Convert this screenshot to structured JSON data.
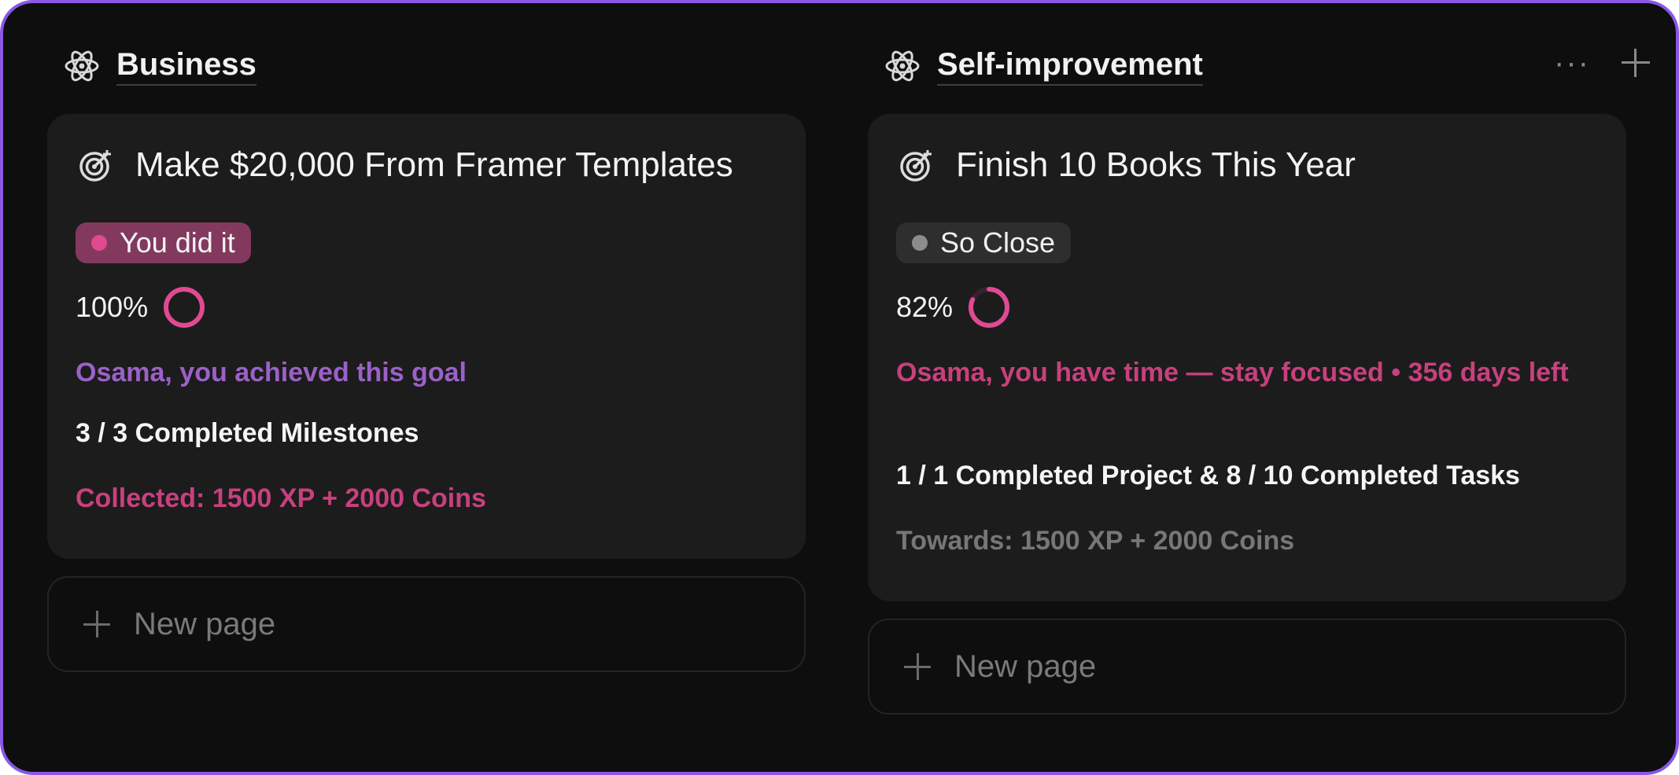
{
  "colors": {
    "frame_border": "#8b57e6",
    "background": "#0e0e0e",
    "card": "#1c1c1c",
    "pink": "#e04a92",
    "purple_text": "#9b61c8"
  },
  "columns": [
    {
      "title": "Business",
      "icon": "atom-icon",
      "card": {
        "icon": "target-icon",
        "title": "Make $20,000 From Framer Templates",
        "status": "You did it",
        "progress_label": "100%",
        "progress": 1.0,
        "message": "Osama, you achieved this goal",
        "milestones": "3 / 3 Completed Milestones",
        "reward": "Collected: 1500 XP + 2000 Coins"
      },
      "new_page_label": "New page"
    },
    {
      "title": "Self-improvement",
      "icon": "atom-icon",
      "card": {
        "icon": "target-icon",
        "title": "Finish 10 Books This Year",
        "status": "So Close",
        "progress_label": "82%",
        "progress": 0.82,
        "message": "Osama, you have time — stay focused • 356 days left",
        "milestones": "1 / 1 Completed Project & 8 / 10 Completed Tasks",
        "reward": "Towards: 1500 XP + 2000 Coins"
      },
      "new_page_label": "New page"
    }
  ],
  "header_actions": {
    "more": "···"
  }
}
